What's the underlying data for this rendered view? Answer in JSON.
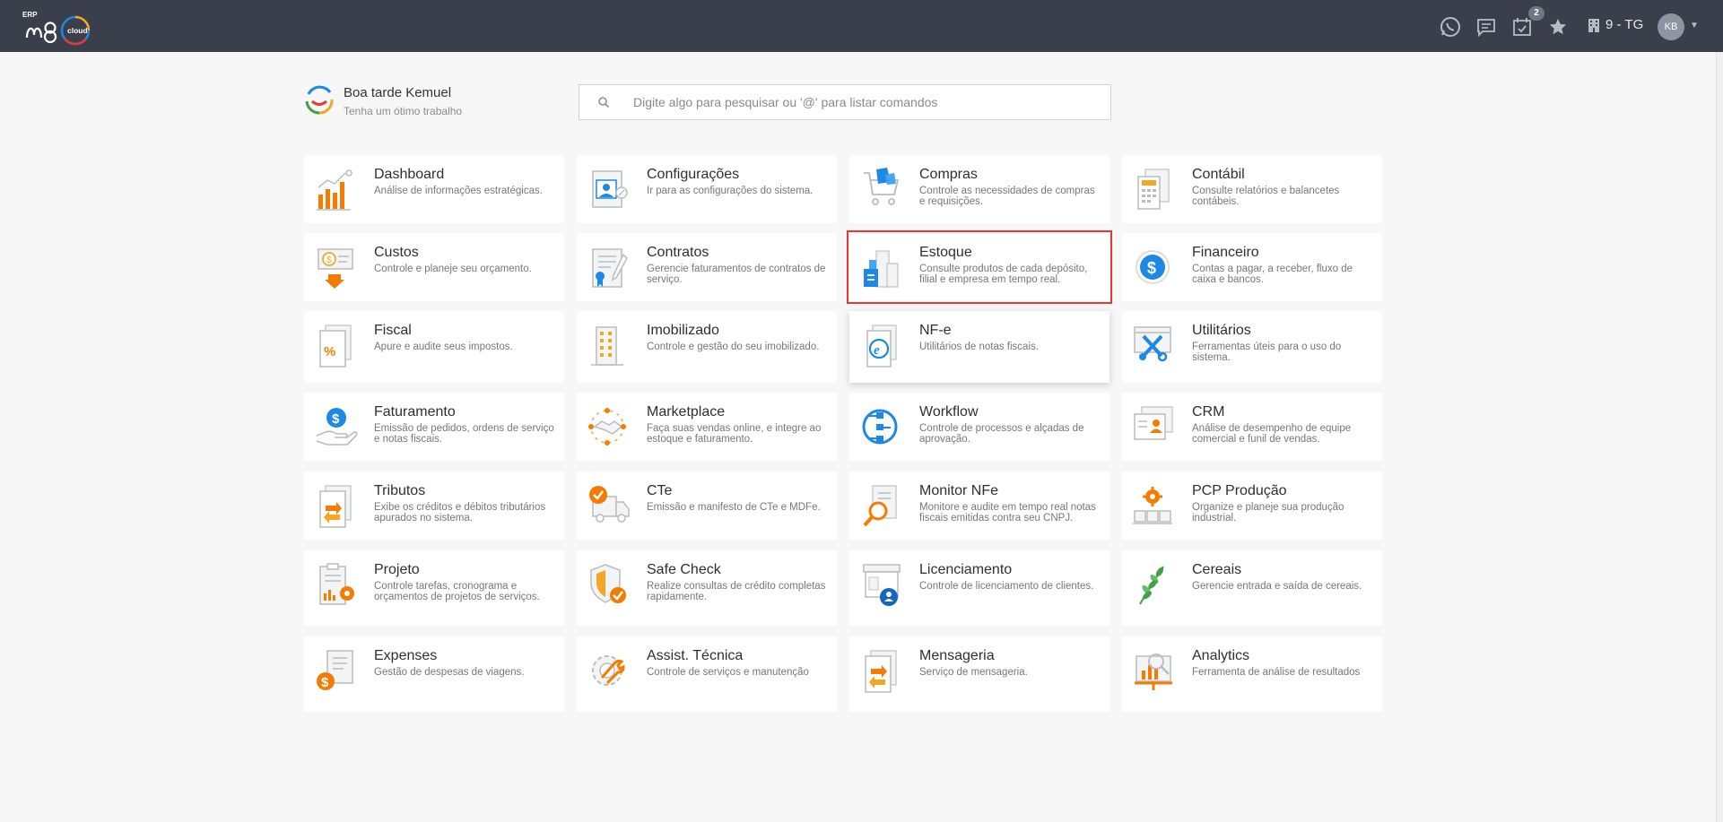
{
  "header": {
    "logo_text": "ERP m8 cloud",
    "notification_count": "2",
    "company": "9 - TG",
    "user_initials": "KB"
  },
  "greeting": {
    "title": "Boa tarde Kemuel",
    "subtitle": "Tenha um ótimo trabalho"
  },
  "search": {
    "placeholder": "Digite algo para pesquisar ou '@' para listar comandos"
  },
  "modules": [
    [
      {
        "title": "Dashboard",
        "desc": "Análise de informações estratégicas.",
        "icon": "chart-icon"
      },
      {
        "title": "Configurações",
        "desc": "Ir para as configurações do sistema.",
        "icon": "settings-icon"
      },
      {
        "title": "Compras",
        "desc": "Controle as necessidades de compras e requisições.",
        "icon": "cart-icon"
      },
      {
        "title": "Contábil",
        "desc": "Consulte relatórios e balancetes contábeis.",
        "icon": "calculator-icon"
      }
    ],
    [
      {
        "title": "Custos",
        "desc": "Controle e planeje seu orçamento.",
        "icon": "costs-icon"
      },
      {
        "title": "Contratos",
        "desc": "Gerencie faturamentos de contratos de serviço.",
        "icon": "contract-icon"
      },
      {
        "title": "Estoque",
        "desc": "Consulte produtos de cada depósito, filial e empresa em tempo real.",
        "icon": "stock-icon"
      },
      {
        "title": "Financeiro",
        "desc": "Contas a pagar, a receber, fluxo de caixa e bancos.",
        "icon": "dollar-icon"
      }
    ],
    [
      {
        "title": "Fiscal",
        "desc": "Apure e audite seus impostos.",
        "icon": "percent-icon"
      },
      {
        "title": "Imobilizado",
        "desc": "Controle e gestão do seu imobilizado.",
        "icon": "building-icon"
      },
      {
        "title": "NF-e",
        "desc": "Utilitários de notas fiscais.",
        "icon": "nfe-icon"
      },
      {
        "title": "Utilitários",
        "desc": "Ferramentas úteis para o uso do sistema.",
        "icon": "tools-icon"
      }
    ],
    [
      {
        "title": "Faturamento",
        "desc": "Emissão de pedidos, ordens de serviço e notas fiscais.",
        "icon": "billing-icon"
      },
      {
        "title": "Marketplace",
        "desc": "Faça suas vendas online, e integre ao estoque e faturamento.",
        "icon": "handshake-icon"
      },
      {
        "title": "Workflow",
        "desc": "Controle de processos e alçadas de aprovação.",
        "icon": "workflow-icon"
      },
      {
        "title": "CRM",
        "desc": "Análise de desempenho de equipe comercial e funil de vendas.",
        "icon": "crm-icon"
      }
    ],
    [
      {
        "title": "Tributos",
        "desc": "Exibe os créditos e débitos tributários apurados no sistema.",
        "icon": "exchange-icon"
      },
      {
        "title": "CTe",
        "desc": "Emissão e manifesto de CTe e MDFe.",
        "icon": "truck-icon"
      },
      {
        "title": "Monitor NFe",
        "desc": "Monitore e audite em tempo real notas fiscais emitidas contra seu CNPJ.",
        "icon": "magnifier-icon"
      },
      {
        "title": "PCP Produção",
        "desc": "Organize e planeje sua produção industrial.",
        "icon": "production-icon"
      }
    ],
    [
      {
        "title": "Projeto",
        "desc": "Controle tarefas, cronograma e orçamentos de projetos de serviços.",
        "icon": "project-icon"
      },
      {
        "title": "Safe Check",
        "desc": "Realize consultas de crédito completas rapidamente.",
        "icon": "shield-icon"
      },
      {
        "title": "Licenciamento",
        "desc": "Controle de licenciamento de clientes.",
        "icon": "license-icon"
      },
      {
        "title": "Cereais",
        "desc": "Gerencie entrada e saída de cereais.",
        "icon": "grain-icon"
      }
    ],
    [
      {
        "title": "Expenses",
        "desc": "Gestão de despesas de viagens.",
        "icon": "expenses-icon"
      },
      {
        "title": "Assist. Técnica",
        "desc": "Controle de serviços e manutenção",
        "icon": "wrench-icon"
      },
      {
        "title": "Mensageria",
        "desc": "Serviço de mensageria.",
        "icon": "message-icon"
      },
      {
        "title": "Analytics",
        "desc": "Ferramenta de análise de resultados",
        "icon": "analytics-icon"
      }
    ]
  ]
}
